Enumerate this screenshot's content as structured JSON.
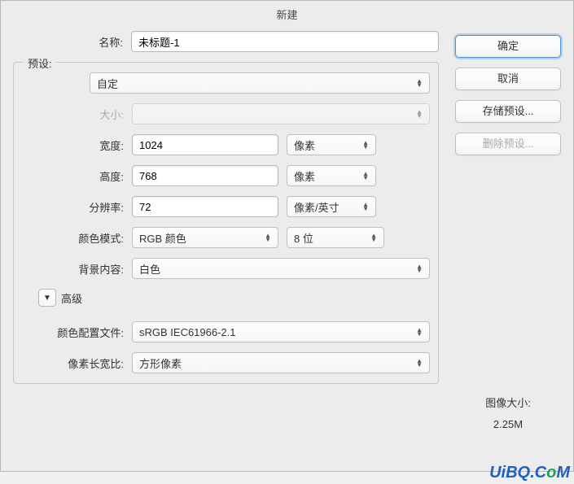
{
  "title": "新建",
  "fields": {
    "name_label": "名称:",
    "name_value": "未标题-1",
    "preset_label": "预设:",
    "preset_value": "自定",
    "size_label": "大小:",
    "size_value": "",
    "width_label": "宽度:",
    "width_value": "1024",
    "width_unit": "像素",
    "height_label": "高度:",
    "height_value": "768",
    "height_unit": "像素",
    "resolution_label": "分辨率:",
    "resolution_value": "72",
    "resolution_unit": "像素/英寸",
    "colormode_label": "颜色模式:",
    "colormode_value": "RGB 颜色",
    "colordepth_value": "8 位",
    "bgcontent_label": "背景内容:",
    "bgcontent_value": "白色",
    "advanced_label": "高级",
    "colorprofile_label": "颜色配置文件:",
    "colorprofile_value": "sRGB IEC61966-2.1",
    "pixelratio_label": "像素长宽比:",
    "pixelratio_value": "方形像素"
  },
  "buttons": {
    "ok": "确定",
    "cancel": "取消",
    "save_preset": "存储预设...",
    "delete_preset": "删除预设..."
  },
  "imagesize": {
    "label": "图像大小:",
    "value": "2.25M"
  },
  "watermark": "UiBQ.CoM"
}
